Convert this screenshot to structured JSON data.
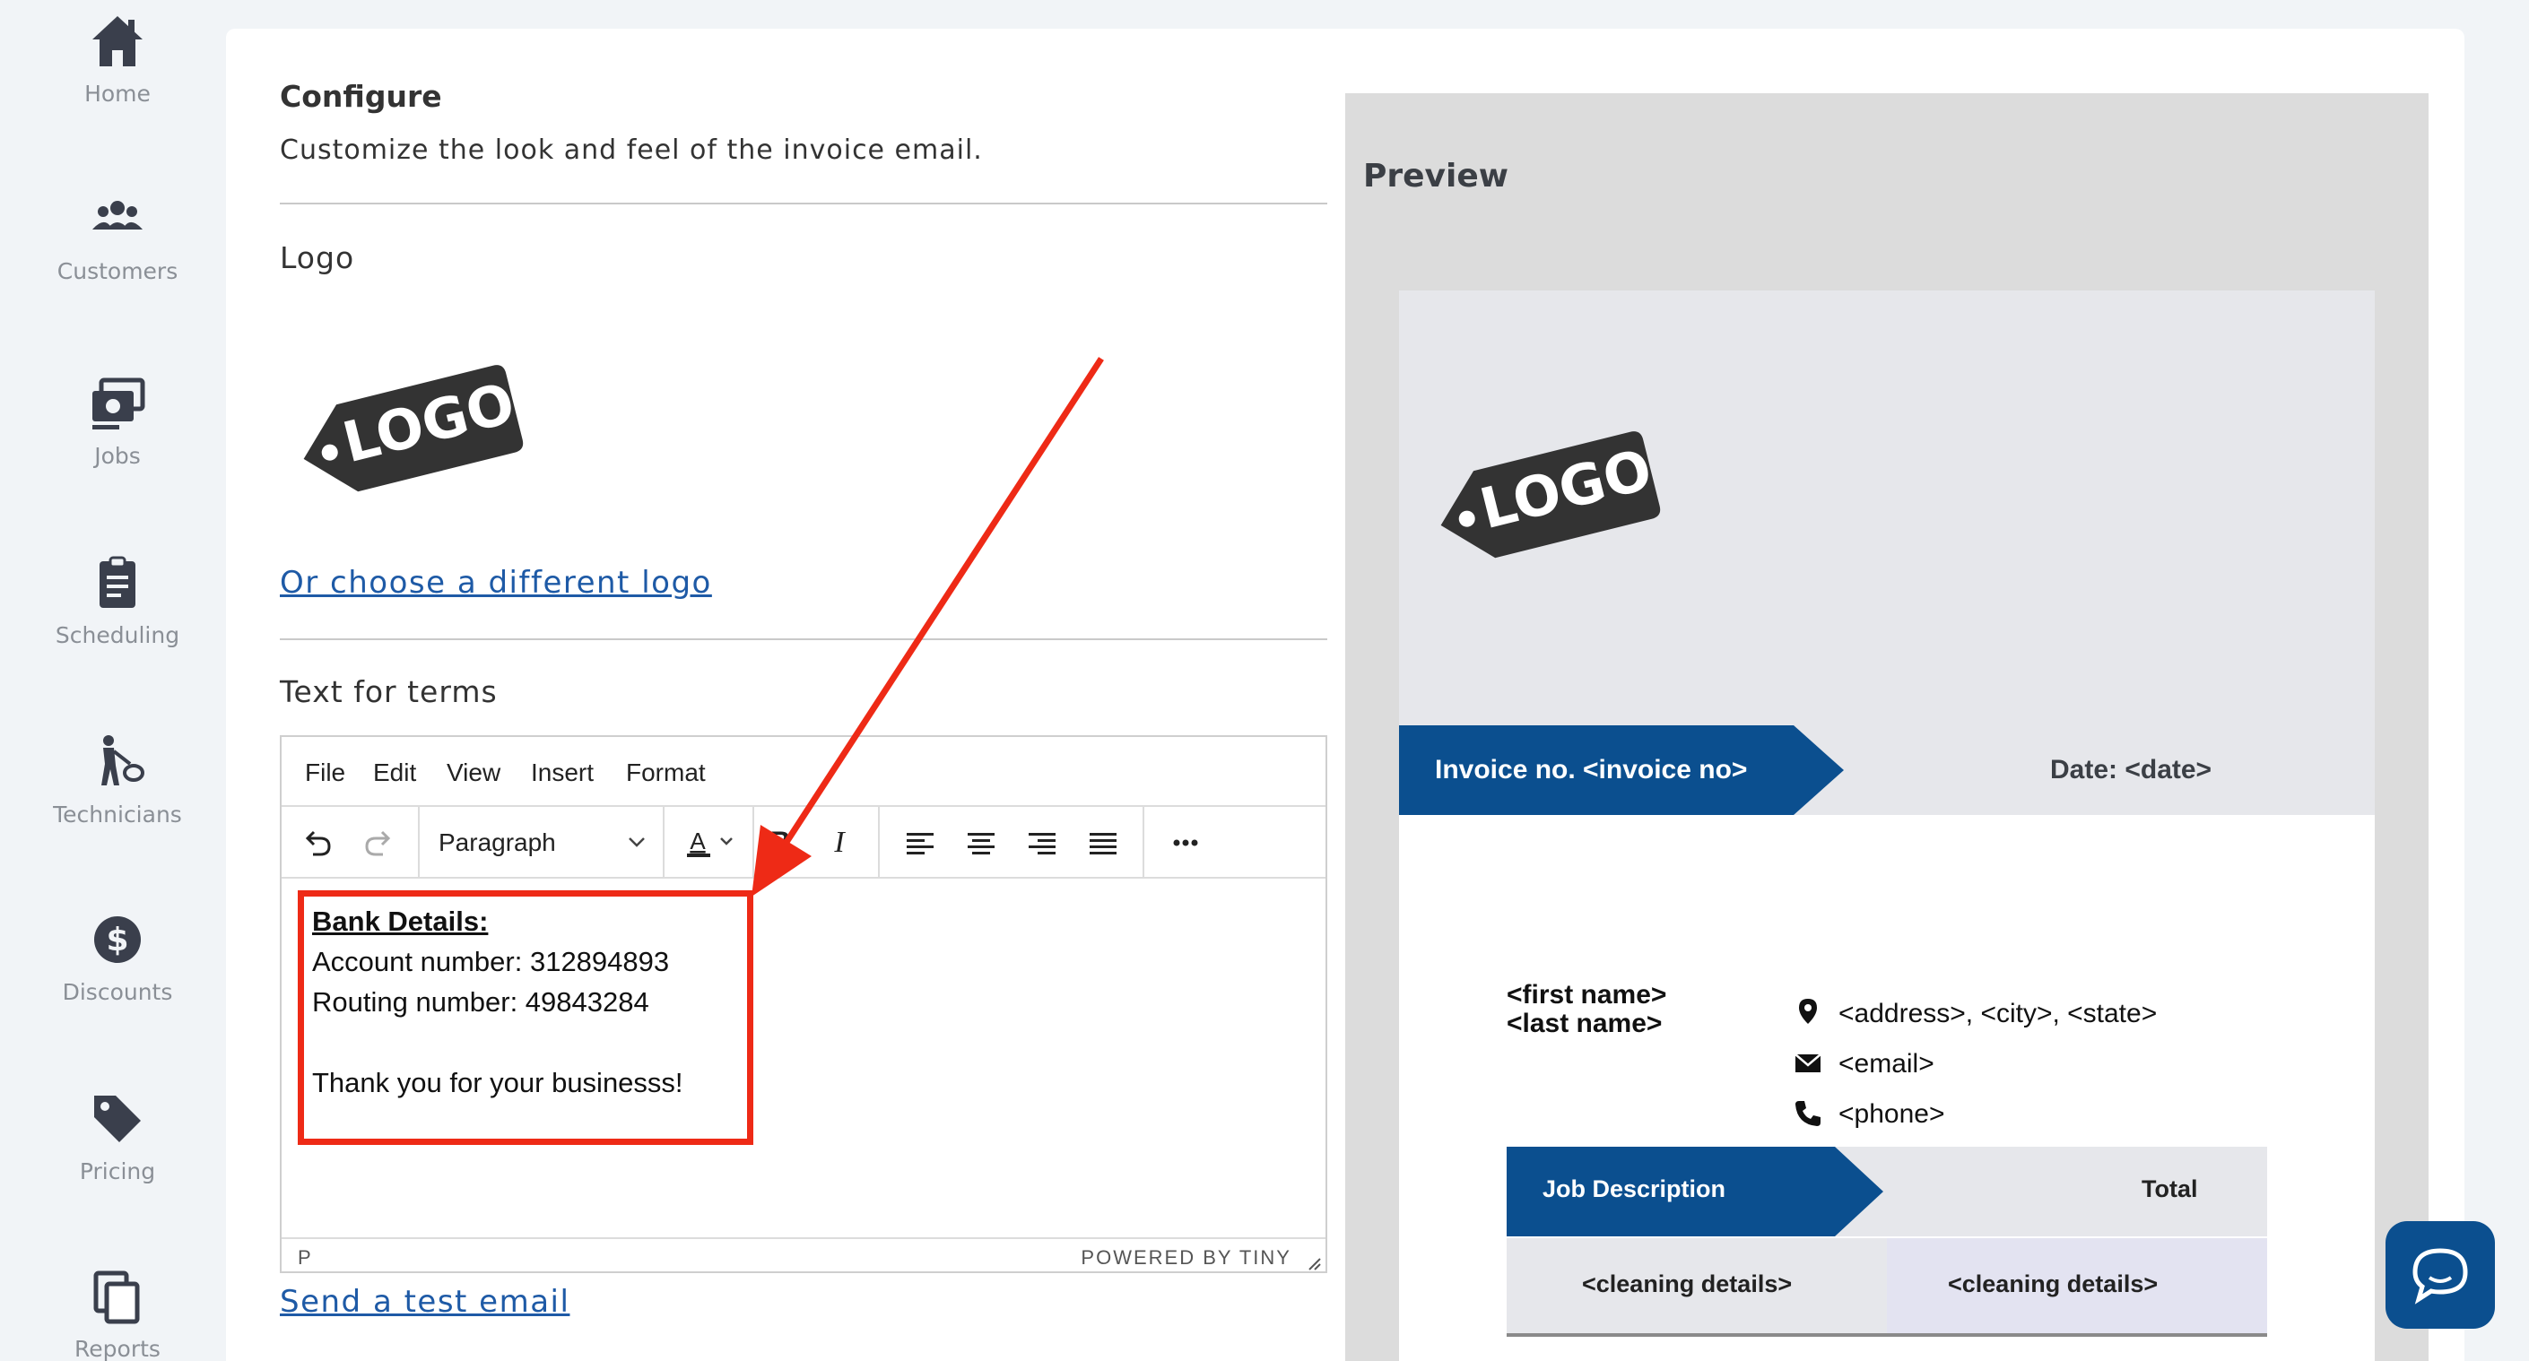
{
  "sidebar": {
    "items": [
      {
        "label": "Home",
        "icon": "home-icon"
      },
      {
        "label": "Customers",
        "icon": "customers-icon"
      },
      {
        "label": "Jobs",
        "icon": "jobs-icon"
      },
      {
        "label": "Scheduling",
        "icon": "clipboard-icon"
      },
      {
        "label": "Technicians",
        "icon": "technician-icon"
      },
      {
        "label": "Discounts",
        "icon": "dollar-icon"
      },
      {
        "label": "Pricing",
        "icon": "tag-icon"
      },
      {
        "label": "Reports",
        "icon": "copy-icon"
      }
    ]
  },
  "configure": {
    "title": "Configure",
    "subtitle": "Customize the look and feel of the invoice email.",
    "logo_label": "Logo",
    "logo_text": "LOGO",
    "change_logo_link": "Or choose a different logo",
    "terms_label": "Text for terms",
    "send_test_link": "Send a test email"
  },
  "editor": {
    "menu": [
      "File",
      "Edit",
      "View",
      "Insert",
      "Format"
    ],
    "block_format": "Paragraph",
    "content": {
      "heading": "Bank Details: ",
      "line1": "Account number: 312894893",
      "line2": "Routing number: 49843284",
      "line3": "Thank you for your businesss!"
    },
    "status_path": "P",
    "powered_by": "POWERED BY TINY"
  },
  "preview": {
    "title": "Preview",
    "logo_text": "LOGO",
    "invoice_no": "Invoice no. <invoice no>",
    "date": "Date: <date>",
    "first_name": "<first name>",
    "last_name": "<last name>",
    "address": "<address>, <city>, <state>",
    "email": "<email>",
    "phone": "<phone>",
    "job_description_header": "Job Description",
    "total_header": "Total",
    "row_left": "<cleaning details>",
    "row_right": "<cleaning details>"
  },
  "colors": {
    "accent_blue": "#0b4f8f",
    "link_blue": "#1e5aa6",
    "annotation_red": "#ee2a16",
    "logo_dark": "#333333"
  }
}
